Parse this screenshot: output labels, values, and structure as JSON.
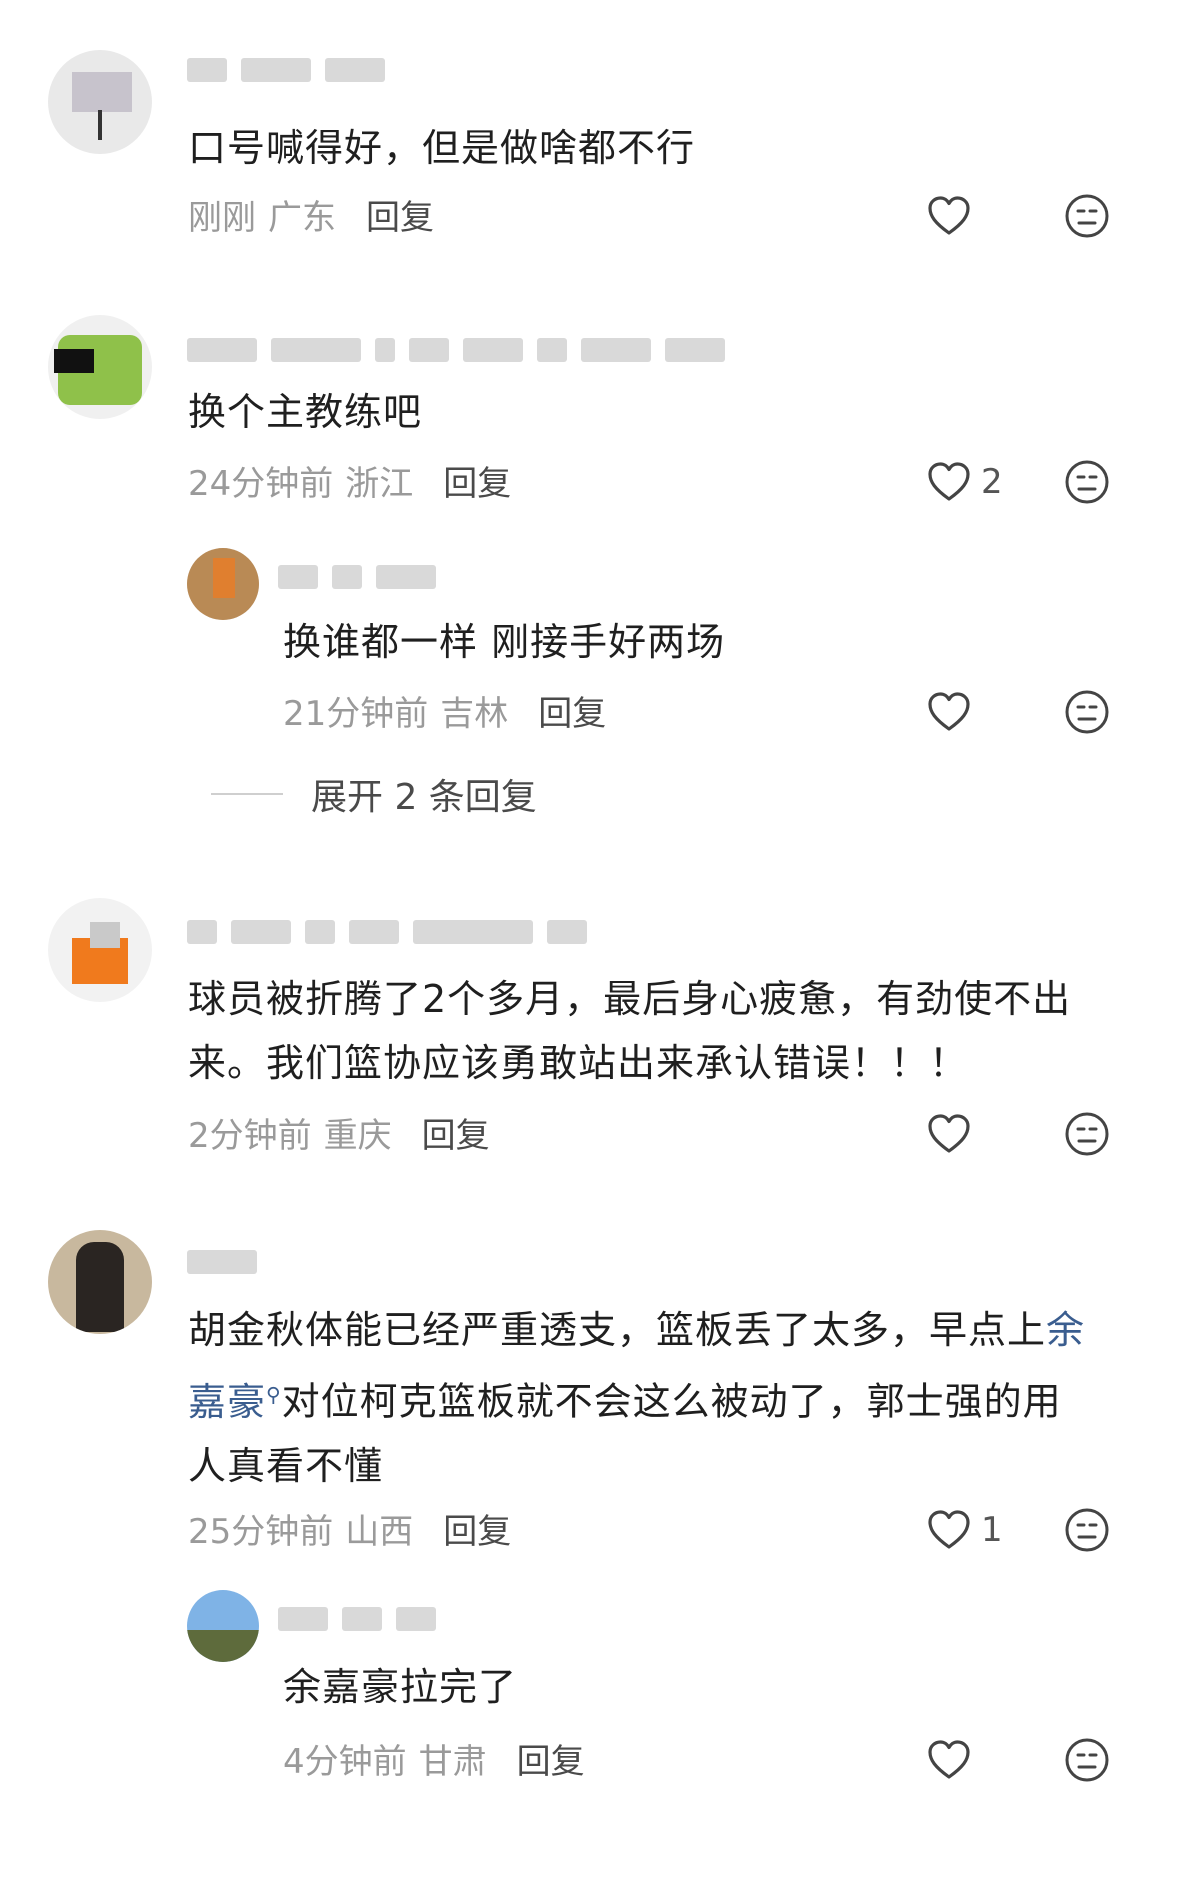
{
  "comments": [
    {
      "text": "口号喊得好，但是做啥都不行",
      "time": "刚刚",
      "location": "广东",
      "reply": "回复",
      "likes": ""
    },
    {
      "text": "换个主教练吧",
      "time": "24分钟前",
      "location": "浙江",
      "reply": "回复",
      "likes": "2",
      "replies": [
        {
          "text": "换谁都一样 刚接手好两场",
          "time": "21分钟前",
          "location": "吉林",
          "reply": "回复",
          "likes": ""
        }
      ],
      "expand": "展开 2 条回复"
    },
    {
      "text": "球员被折腾了2个多月，最后身心疲惫，有劲使不出来。我们篮协应该勇敢站出来承认错误！！！",
      "time": "2分钟前",
      "location": "重庆",
      "reply": "回复",
      "likes": ""
    },
    {
      "text_pre": "胡金秋体能已经严重透支，篮板丢了太多，早点上",
      "mention": "余嘉豪",
      "text_post": "对位柯克篮板就不会这么被动了，郭士强的用人真看不懂",
      "time": "25分钟前",
      "location": "山西",
      "reply": "回复",
      "likes": "1",
      "replies": [
        {
          "text": "余嘉豪拉完了",
          "time": "4分钟前",
          "location": "甘肃",
          "reply": "回复",
          "likes": ""
        }
      ]
    }
  ],
  "icons": {
    "like": "heart-outline-icon",
    "dislike": "meh-face-icon",
    "search": "search-superscript-icon"
  }
}
